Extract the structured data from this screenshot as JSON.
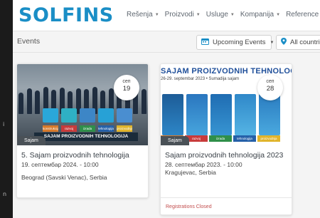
{
  "left_strip": {
    "marks": [
      "i",
      "n"
    ]
  },
  "header": {
    "logo": "SOLFINS",
    "nav": [
      {
        "label": "Rešenja"
      },
      {
        "label": "Proizvodi"
      },
      {
        "label": "Usluge"
      },
      {
        "label": "Kompanija"
      },
      {
        "label": "Reference"
      }
    ],
    "plus_icon": "plus-icon"
  },
  "toolbar": {
    "title": "Events",
    "upcoming_label": "Upcoming Events",
    "countries_label": "All countries"
  },
  "events": [
    {
      "badge_month": "сеп",
      "badge_day": "19",
      "tag": "Sajam",
      "title": "5. Sajam proizvodnih tehnologija",
      "date": "19. септембар 2024. - 10:00",
      "location": "Beograd (Savski Venac), Serbia",
      "image_banner": "SAJAM PROIZVODNIH TEHNOLOGIJA",
      "image_stripes": [
        "konstrukcija",
        "razvoj",
        "izrada",
        "tehnologija",
        "proizvodnja"
      ]
    },
    {
      "badge_month": "сеп",
      "badge_day": "28",
      "tag": "Sajam",
      "title": "Sajam proizvodnih tehnologija 2023",
      "date": "28. септембар 2023. - 10:00",
      "location": "Kragujevac, Serbia",
      "status": "Registrations Closed",
      "image_title": "SAJAM PROIZVODNIH TEHNOLOGIJA",
      "image_sub": "26-29. septembar 2023 • Sumadija sajam",
      "image_stripes": [
        "konstrukcija",
        "razvoj",
        "izrada",
        "tehnologija",
        "proizvodnja"
      ]
    }
  ],
  "colors": {
    "brand": "#1a8ec6",
    "status_closed": "#c24d4d",
    "tag_bg": "#4a5157"
  }
}
